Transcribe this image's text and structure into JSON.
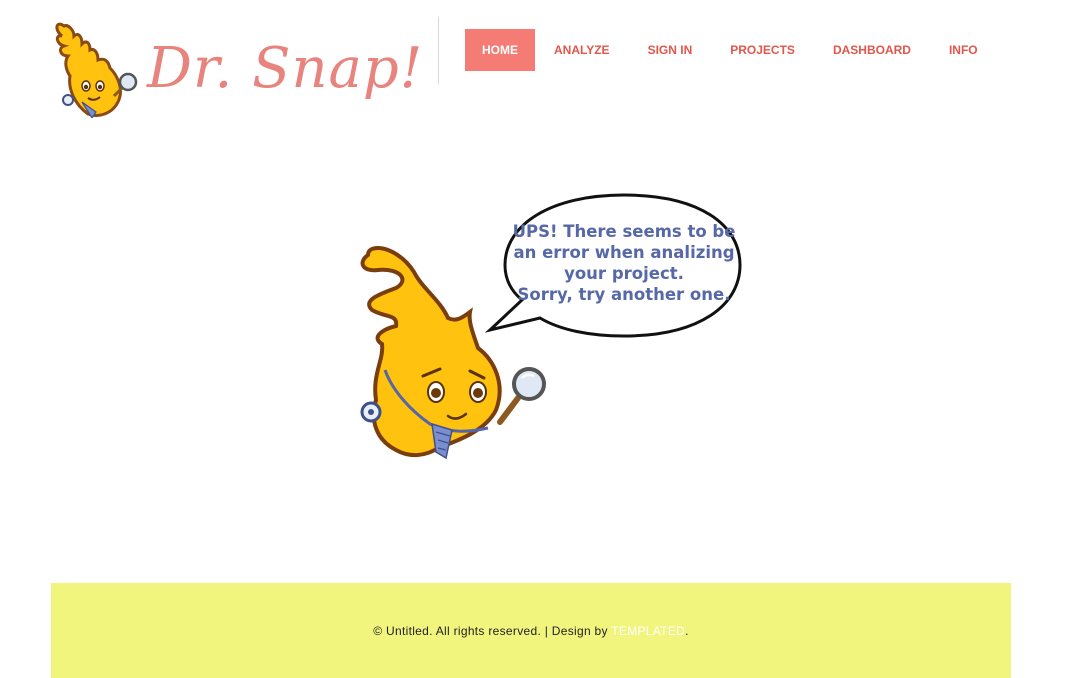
{
  "header": {
    "logo_text": "Dr. Snap!"
  },
  "nav": {
    "items": [
      {
        "label": "HOME",
        "active": true
      },
      {
        "label": "ANALYZE",
        "active": false
      },
      {
        "label": "SIGN IN",
        "active": false
      },
      {
        "label": "PROJECTS",
        "active": false
      },
      {
        "label": "DASHBOARD",
        "active": false
      },
      {
        "label": "INFO",
        "active": false
      }
    ]
  },
  "main": {
    "error_message_lines": [
      "UPS! There seems to be",
      "an error when analizing",
      "your project.",
      "Sorry, try another one."
    ]
  },
  "footer": {
    "text_prefix": "© Untitled. All rights reserved. | Design by ",
    "link_text": "TEMPLATED",
    "text_suffix": "."
  },
  "colors": {
    "brand": "#e9837e",
    "nav_text": "#e0574b",
    "nav_active_bg": "#f47c74",
    "footer_bg": "#f1f57d",
    "bubble_text": "#5668a6"
  }
}
